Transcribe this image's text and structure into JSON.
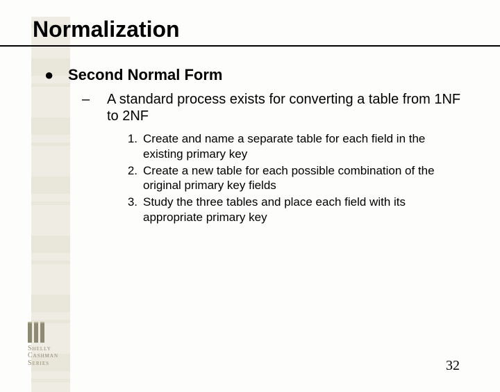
{
  "title": "Normalization",
  "bullet1": {
    "marker": "●",
    "text": "Second Normal Form"
  },
  "bullet2": {
    "marker": "–",
    "text": "A standard process exists for converting a table from 1NF to 2NF"
  },
  "steps": [
    {
      "num": "1.",
      "text": "Create and name a separate table for each field in the existing primary key"
    },
    {
      "num": "2.",
      "text": "Create a new table for each possible combination of the original primary key fields"
    },
    {
      "num": "3.",
      "text": "Study the three tables and place each field with its appropriate primary key"
    }
  ],
  "logo": {
    "line1": "Shelly",
    "line2": "Cashman",
    "line3": "Series"
  },
  "page_number": "32"
}
